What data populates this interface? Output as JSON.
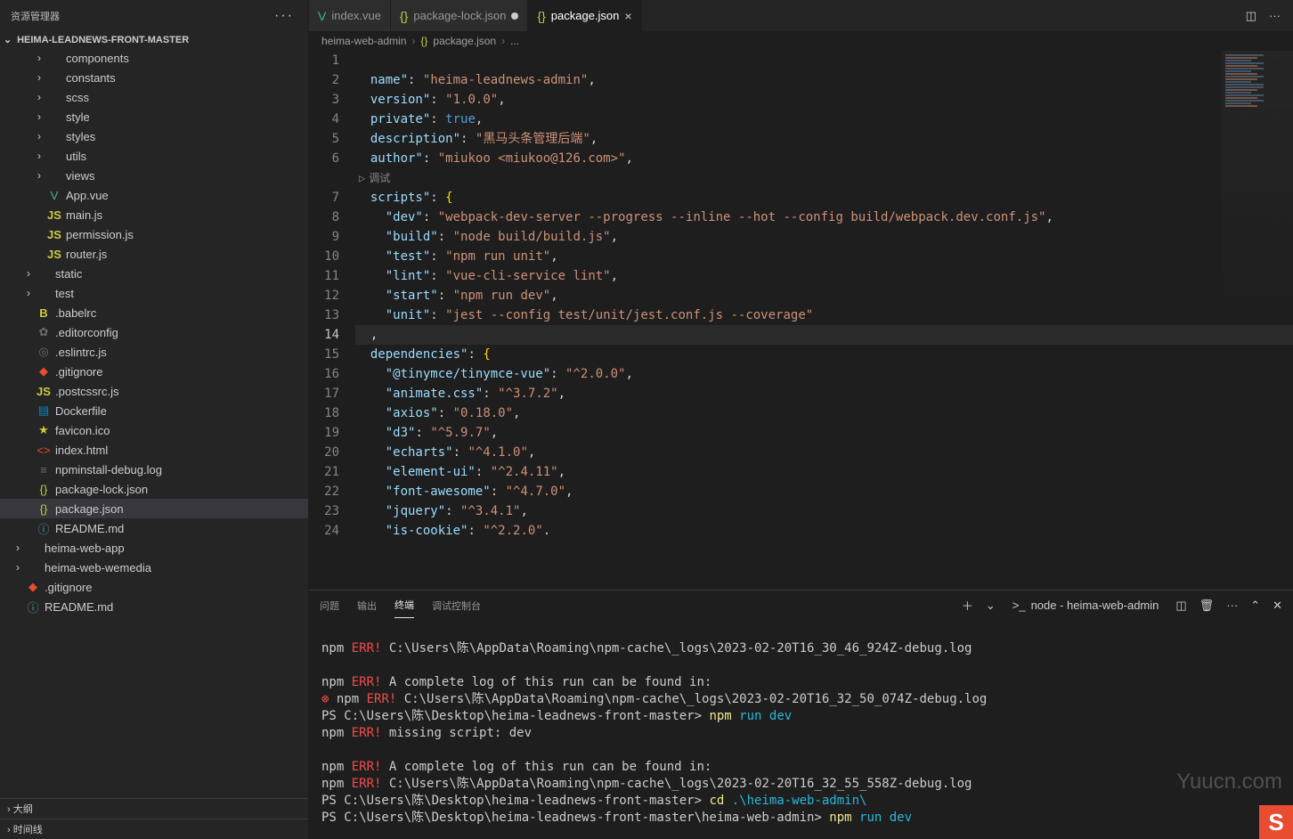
{
  "sidebar": {
    "title": "资源管理器",
    "more": "···",
    "project": "HEIMA-LEADNEWS-FRONT-MASTER",
    "items": [
      {
        "indent": 36,
        "chev": "›",
        "icon": "",
        "label": "components",
        "cls": ""
      },
      {
        "indent": 36,
        "chev": "›",
        "icon": "",
        "label": "constants",
        "cls": ""
      },
      {
        "indent": 36,
        "chev": "›",
        "icon": "",
        "label": "scss",
        "cls": ""
      },
      {
        "indent": 36,
        "chev": "›",
        "icon": "",
        "label": "style",
        "cls": ""
      },
      {
        "indent": 36,
        "chev": "›",
        "icon": "",
        "label": "styles",
        "cls": ""
      },
      {
        "indent": 36,
        "chev": "›",
        "icon": "",
        "label": "utils",
        "cls": ""
      },
      {
        "indent": 36,
        "chev": "›",
        "icon": "",
        "label": "views",
        "cls": ""
      },
      {
        "indent": 36,
        "chev": "",
        "icon": "V",
        "label": "App.vue",
        "cls": "ic-vue"
      },
      {
        "indent": 36,
        "chev": "",
        "icon": "JS",
        "label": "main.js",
        "cls": "ic-js"
      },
      {
        "indent": 36,
        "chev": "",
        "icon": "JS",
        "label": "permission.js",
        "cls": "ic-js"
      },
      {
        "indent": 36,
        "chev": "",
        "icon": "JS",
        "label": "router.js",
        "cls": "ic-js"
      },
      {
        "indent": 24,
        "chev": "›",
        "icon": "",
        "label": "static",
        "cls": ""
      },
      {
        "indent": 24,
        "chev": "›",
        "icon": "",
        "label": "test",
        "cls": ""
      },
      {
        "indent": 24,
        "chev": "",
        "icon": "B",
        "label": ".babelrc",
        "cls": "ic-js"
      },
      {
        "indent": 24,
        "chev": "",
        "icon": "✿",
        "label": ".editorconfig",
        "cls": "ic-config"
      },
      {
        "indent": 24,
        "chev": "",
        "icon": "◎",
        "label": ".eslintrc.js",
        "cls": "ic-config"
      },
      {
        "indent": 24,
        "chev": "",
        "icon": "◆",
        "label": ".gitignore",
        "cls": "ic-git"
      },
      {
        "indent": 24,
        "chev": "",
        "icon": "JS",
        "label": ".postcssrc.js",
        "cls": "ic-js"
      },
      {
        "indent": 24,
        "chev": "",
        "icon": "▤",
        "label": "Dockerfile",
        "cls": "ic-docker"
      },
      {
        "indent": 24,
        "chev": "",
        "icon": "★",
        "label": "favicon.ico",
        "cls": "ic-fav"
      },
      {
        "indent": 24,
        "chev": "",
        "icon": "<>",
        "label": "index.html",
        "cls": "ic-html"
      },
      {
        "indent": 24,
        "chev": "",
        "icon": "≡",
        "label": "npminstall-debug.log",
        "cls": "ic-txt"
      },
      {
        "indent": 24,
        "chev": "",
        "icon": "{}",
        "label": "package-lock.json",
        "cls": "ic-json"
      },
      {
        "indent": 24,
        "chev": "",
        "icon": "{}",
        "label": "package.json",
        "cls": "ic-json",
        "selected": true
      },
      {
        "indent": 24,
        "chev": "",
        "icon": "ⓘ",
        "label": "README.md",
        "cls": "ic-md"
      },
      {
        "indent": 12,
        "chev": "›",
        "icon": "",
        "label": "heima-web-app",
        "cls": ""
      },
      {
        "indent": 12,
        "chev": "›",
        "icon": "",
        "label": "heima-web-wemedia",
        "cls": ""
      },
      {
        "indent": 12,
        "chev": "",
        "icon": "◆",
        "label": ".gitignore",
        "cls": "ic-git"
      },
      {
        "indent": 12,
        "chev": "",
        "icon": "ⓘ",
        "label": "README.md",
        "cls": "ic-md"
      }
    ],
    "outline": "大纲",
    "timeline": "时间线"
  },
  "tabs": {
    "items": [
      {
        "icon": "V",
        "iconCls": "ic-vue",
        "label": "index.vue",
        "active": false,
        "dirty": false
      },
      {
        "icon": "{}",
        "iconCls": "ic-json",
        "label": "package-lock.json",
        "active": false,
        "dirty": true
      },
      {
        "icon": "{}",
        "iconCls": "ic-json",
        "label": "package.json",
        "active": true,
        "dirty": false
      }
    ]
  },
  "breadcrumb": {
    "parts": [
      "heima-web-admin",
      "package.json",
      "..."
    ],
    "icon": "{}"
  },
  "editor": {
    "debugLens": "调试",
    "currentLine": 14,
    "lines": [
      {
        "n": 1,
        "html": ""
      },
      {
        "n": 2,
        "html": "  <span class='tok-key'>name\"</span><span class='tok-punc'>:</span> <span class='tok-str'>\"heima-leadnews-admin\"</span><span class='tok-punc'>,</span>"
      },
      {
        "n": 3,
        "html": "  <span class='tok-key'>version\"</span><span class='tok-punc'>:</span> <span class='tok-str'>\"1.0.0\"</span><span class='tok-punc'>,</span>"
      },
      {
        "n": 4,
        "html": "  <span class='tok-key'>private\"</span><span class='tok-punc'>:</span> <span class='tok-bool'>true</span><span class='tok-punc'>,</span>"
      },
      {
        "n": 5,
        "html": "  <span class='tok-key'>description\"</span><span class='tok-punc'>:</span> <span class='tok-str'>\"黑马头条管理后端\"</span><span class='tok-punc'>,</span>"
      },
      {
        "n": 6,
        "html": "  <span class='tok-key'>author\"</span><span class='tok-punc'>:</span> <span class='tok-str'>\"miukoo &lt;miukoo@126.com&gt;\"</span><span class='tok-punc'>,</span>"
      },
      {
        "n": "lens",
        "html": ""
      },
      {
        "n": 7,
        "html": "  <span class='tok-key'>scripts\"</span><span class='tok-punc'>:</span> <span class='tok-brace'>{</span>"
      },
      {
        "n": 8,
        "html": "    <span class='tok-key'>\"dev\"</span><span class='tok-punc'>:</span> <span class='tok-str'>\"webpack-dev-server --progress --inline --hot --config build/webpack.dev.conf.js\"</span><span class='tok-punc'>,</span>"
      },
      {
        "n": 9,
        "html": "    <span class='tok-key'>\"build\"</span><span class='tok-punc'>:</span> <span class='tok-str'>\"node build/build.js\"</span><span class='tok-punc'>,</span>"
      },
      {
        "n": 10,
        "html": "    <span class='tok-key'>\"test\"</span><span class='tok-punc'>:</span> <span class='tok-str'>\"npm run unit\"</span><span class='tok-punc'>,</span>"
      },
      {
        "n": 11,
        "html": "    <span class='tok-key'>\"lint\"</span><span class='tok-punc'>:</span> <span class='tok-str'>\"vue-cli-service lint\"</span><span class='tok-punc'>,</span>"
      },
      {
        "n": 12,
        "html": "    <span class='tok-key'>\"start\"</span><span class='tok-punc'>:</span> <span class='tok-str'>\"npm run dev\"</span><span class='tok-punc'>,</span>"
      },
      {
        "n": 13,
        "html": "    <span class='tok-key'>\"unit\"</span><span class='tok-punc'>:</span> <span class='tok-str'>\"jest --config test/unit/jest.conf.js --coverage\"</span>"
      },
      {
        "n": 14,
        "html": "  <span class='tok-punc'>,</span>"
      },
      {
        "n": 15,
        "html": "  <span class='tok-key'>dependencies\"</span><span class='tok-punc'>:</span> <span class='tok-brace'>{</span>"
      },
      {
        "n": 16,
        "html": "    <span class='tok-key'>\"@tinymce/tinymce-vue\"</span><span class='tok-punc'>:</span> <span class='tok-str'>\"^2.0.0\"</span><span class='tok-punc'>,</span>"
      },
      {
        "n": 17,
        "html": "    <span class='tok-key'>\"animate.css\"</span><span class='tok-punc'>:</span> <span class='tok-str'>\"^3.7.2\"</span><span class='tok-punc'>,</span>"
      },
      {
        "n": 18,
        "html": "    <span class='tok-key'>\"axios\"</span><span class='tok-punc'>:</span> <span class='tok-str'>\"0.18.0\"</span><span class='tok-punc'>,</span>"
      },
      {
        "n": 19,
        "html": "    <span class='tok-key'>\"d3\"</span><span class='tok-punc'>:</span> <span class='tok-str'>\"^5.9.7\"</span><span class='tok-punc'>,</span>"
      },
      {
        "n": 20,
        "html": "    <span class='tok-key'>\"echarts\"</span><span class='tok-punc'>:</span> <span class='tok-str'>\"^4.1.0\"</span><span class='tok-punc'>,</span>"
      },
      {
        "n": 21,
        "html": "    <span class='tok-key'>\"element-ui\"</span><span class='tok-punc'>:</span> <span class='tok-str'>\"^2.4.11\"</span><span class='tok-punc'>,</span>"
      },
      {
        "n": 22,
        "html": "    <span class='tok-key'>\"font-awesome\"</span><span class='tok-punc'>:</span> <span class='tok-str'>\"^4.7.0\"</span><span class='tok-punc'>,</span>"
      },
      {
        "n": 23,
        "html": "    <span class='tok-key'>\"jquery\"</span><span class='tok-punc'>:</span> <span class='tok-str'>\"^3.4.1\"</span><span class='tok-punc'>,</span>"
      },
      {
        "n": 24,
        "html": "    <span class='tok-key'>\"is-cookie\"</span><span class='tok-punc'>:</span> <span class='tok-str'>\"^2.2.0\"</span><span class='tok-punc'>.</span>"
      }
    ]
  },
  "panel": {
    "tabs": {
      "problems": "问题",
      "output": "输出",
      "terminal": "终端",
      "debug": "调试控制台"
    },
    "dropdown": "node - heima-web-admin",
    "lines": [
      "",
      "npm <span class='err'>ERR!</span>     <span class='path'>C:\\Users\\陈\\AppData\\Roaming\\npm-cache\\_logs\\2023-02-20T16_30_46_924Z-debug.log</span>",
      "",
      "npm <span class='err'>ERR!</span> A complete log of this run can be found in:",
      "<span class='err-icon'>⊗</span> npm <span class='err'>ERR!</span>     <span class='path'>C:\\Users\\陈\\AppData\\Roaming\\npm-cache\\_logs\\2023-02-20T16_32_50_074Z-debug.log</span>",
      "PS C:\\Users\\陈\\Desktop\\heima-leadnews-front-master> <span class='cmd'>npm</span> <span class='cyan'>run dev</span>",
      "npm <span class='err'>ERR!</span> missing script: dev",
      "",
      "npm <span class='err'>ERR!</span> A complete log of this run can be found in:",
      "npm <span class='err'>ERR!</span>     <span class='path'>C:\\Users\\陈\\AppData\\Roaming\\npm-cache\\_logs\\2023-02-20T16_32_55_558Z-debug.log</span>",
      "PS C:\\Users\\陈\\Desktop\\heima-leadnews-front-master> <span class='cmd'>cd</span> <span class='cyan'>.\\heima-web-admin\\</span>",
      "PS C:\\Users\\陈\\Desktop\\heima-leadnews-front-master\\heima-web-admin> <span class='cmd'>npm</span> <span class='cyan'>run dev</span>"
    ]
  },
  "watermark": "Yuucn.com",
  "logo": "S"
}
